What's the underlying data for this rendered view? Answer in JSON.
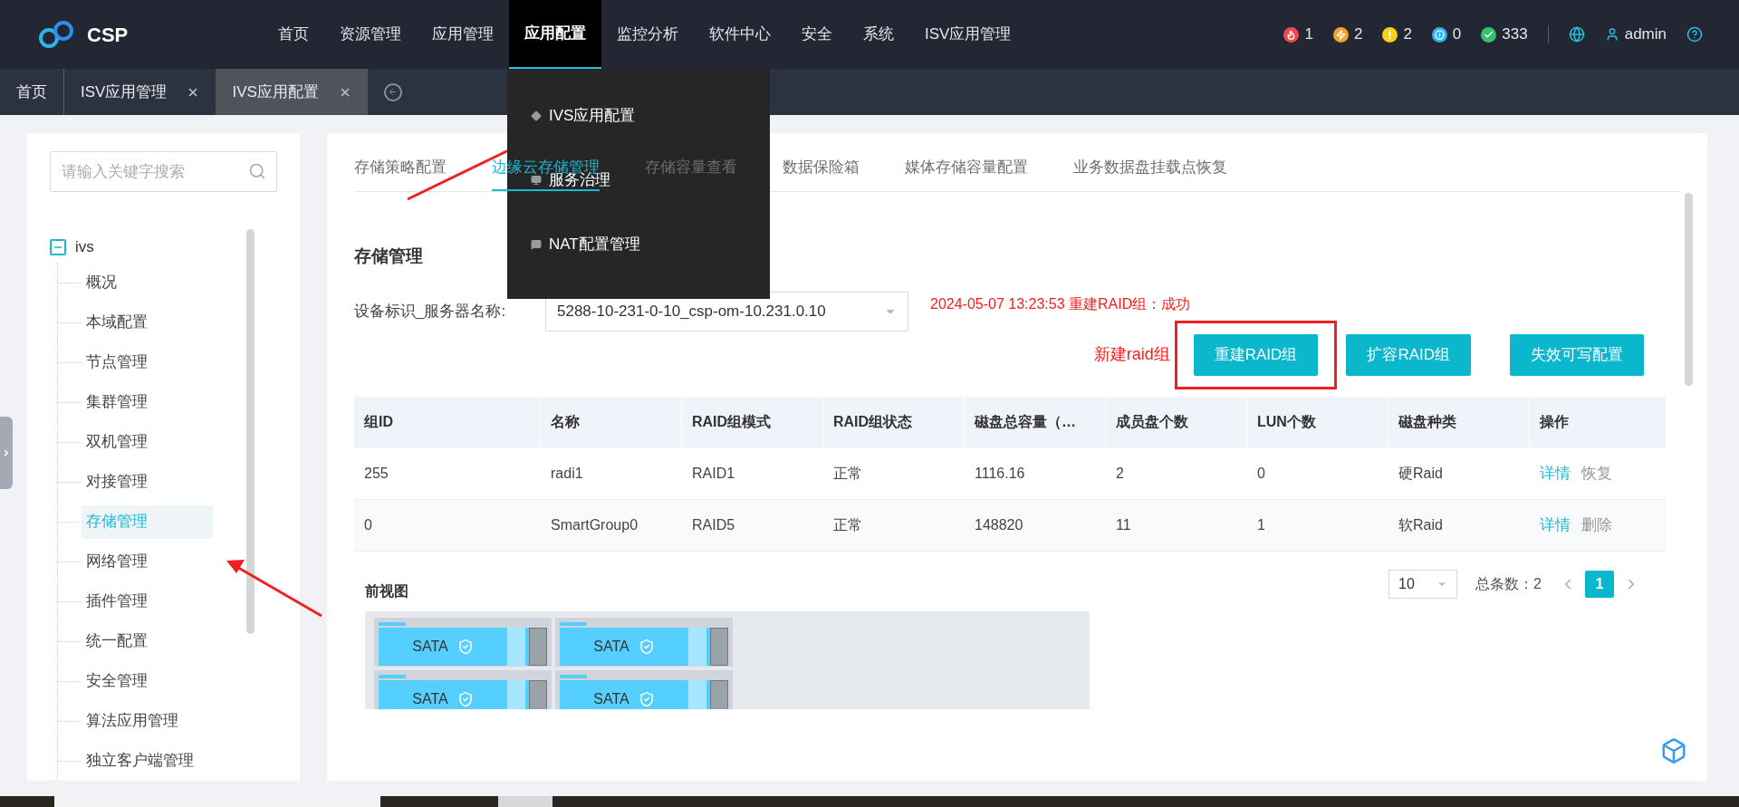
{
  "header": {
    "logo": "CSP",
    "nav": [
      {
        "label": "首页",
        "selected": false
      },
      {
        "label": "资源管理",
        "selected": false
      },
      {
        "label": "应用管理",
        "selected": false
      },
      {
        "label": "应用配置",
        "selected": true
      },
      {
        "label": "监控分析",
        "selected": false
      },
      {
        "label": "软件中心",
        "selected": false
      },
      {
        "label": "安全",
        "selected": false
      },
      {
        "label": "系统",
        "selected": false
      },
      {
        "label": "ISV应用管理",
        "selected": false
      }
    ],
    "alerts": [
      {
        "kind": "fire",
        "count": "1",
        "color": "#f5484a"
      },
      {
        "kind": "bolt",
        "count": "2",
        "color": "#f7a12c"
      },
      {
        "kind": "warning",
        "count": "2",
        "color": "#f2d21c"
      },
      {
        "kind": "info",
        "count": "0",
        "color": "#2fb3f0"
      },
      {
        "kind": "check",
        "count": "333",
        "color": "#36c06a"
      }
    ],
    "user": "admin"
  },
  "page_tabs": [
    {
      "label": "首页",
      "selected": false,
      "closable": false
    },
    {
      "label": "ISV应用管理",
      "selected": false,
      "closable": true
    },
    {
      "label": "IVS应用配置",
      "selected": true,
      "closable": true
    }
  ],
  "dropdown": {
    "items": [
      {
        "kind": "diamond",
        "label": "IVS应用配置"
      },
      {
        "kind": "monitor",
        "label": "服务治理"
      },
      {
        "kind": "chat",
        "label": "NAT配置管理"
      }
    ]
  },
  "sidebar": {
    "search": {
      "placeholder": "请输入关键字搜索"
    },
    "tree": {
      "label": "ivs",
      "expanded": true,
      "children": [
        {
          "label": "概况",
          "selected": false
        },
        {
          "label": "本域配置",
          "selected": false
        },
        {
          "label": "节点管理",
          "selected": false
        },
        {
          "label": "集群管理",
          "selected": false
        },
        {
          "label": "双机管理",
          "selected": false
        },
        {
          "label": "对接管理",
          "selected": false
        },
        {
          "label": "存储管理",
          "selected": true
        },
        {
          "label": "网络管理",
          "selected": false
        },
        {
          "label": "插件管理",
          "selected": false
        },
        {
          "label": "统一配置",
          "selected": false
        },
        {
          "label": "安全管理",
          "selected": false
        },
        {
          "label": "算法应用管理",
          "selected": false
        },
        {
          "label": "独立客户端管理",
          "selected": false
        }
      ]
    }
  },
  "main": {
    "tabs": [
      {
        "label": "存储策略配置",
        "selected": false
      },
      {
        "label": "边缘云存储管理",
        "selected": true
      },
      {
        "label": "存储容量查看",
        "selected": false
      },
      {
        "label": "数据保险箱",
        "selected": false
      },
      {
        "label": "媒体存储容量配置",
        "selected": false
      },
      {
        "label": "业务数据盘挂载点恢复",
        "selected": false
      }
    ],
    "section_title": "存储管理",
    "device_label": "设备标识_服务器名称:",
    "device_value": "5288-10-231-0-10_csp-om-10.231.0.10",
    "status_message": "2024-05-07 13:23:53 重建RAID组：成功",
    "annotation": "新建raid组",
    "buttons": [
      "重建RAID组",
      "扩容RAID组",
      "失效可写配置"
    ],
    "table": {
      "columns": [
        "组ID",
        "名称",
        "RAID组模式",
        "RAID组状态",
        "磁盘总容量（…",
        "成员盘个数",
        "LUN个数",
        "磁盘种类",
        "操作"
      ],
      "rows": [
        {
          "cells": [
            "255",
            "radi1",
            "RAID1",
            "正常",
            "1116.16",
            "2",
            "0",
            "硬Raid"
          ],
          "actions": [
            {
              "label": "详情",
              "kind": "link"
            },
            {
              "label": "恢复",
              "kind": "muted"
            }
          ]
        },
        {
          "cells": [
            "0",
            "SmartGroup0",
            "RAID5",
            "正常",
            "148820",
            "11",
            "1",
            "软Raid"
          ],
          "actions": [
            {
              "label": "详情",
              "kind": "link"
            },
            {
              "label": "删除",
              "kind": "muted"
            }
          ]
        }
      ]
    },
    "pagination": {
      "page_size": "10",
      "total": "总条数：2",
      "pages": [
        {
          "label": "1",
          "selected": true
        }
      ]
    },
    "front_view": {
      "title": "前视图",
      "slots": [
        {
          "label": "SATA"
        },
        {
          "label": "SATA"
        },
        {
          "label": "SATA"
        },
        {
          "label": "SATA"
        }
      ]
    }
  }
}
